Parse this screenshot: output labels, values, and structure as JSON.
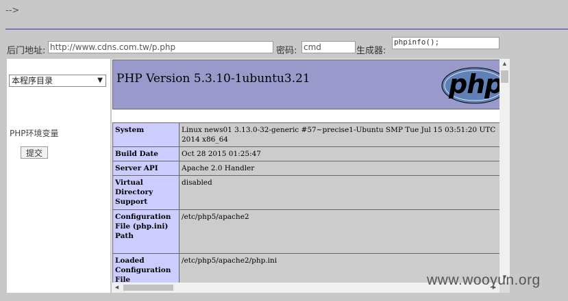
{
  "top": {
    "arrow_text": "-->"
  },
  "form": {
    "backdoor_label": "后门地址:",
    "backdoor_value": "http://www.cdns.com.tw/p.php",
    "password_label": "密码:",
    "password_value": "cmd",
    "generator_label": "生成器:",
    "generator_value": "phpinfo();"
  },
  "sidebar": {
    "dropdown_selected": "本程序目录",
    "env_label": "PHP环境变量",
    "submit_label": "提交"
  },
  "phpinfo": {
    "version_title": "PHP Version 5.3.10-1ubuntu3.21",
    "logo_text": "php",
    "rows": [
      {
        "key": "System",
        "value": "Linux news01 3.13.0-32-generic #57~precise1-Ubuntu SMP Tue Jul 15 03:51:20 UTC 2014 x86_64"
      },
      {
        "key": "Build Date",
        "value": "Oct 28 2015 01:25:47"
      },
      {
        "key": "Server API",
        "value": "Apache 2.0 Handler"
      },
      {
        "key": "Virtual Directory Support",
        "value": "disabled"
      },
      {
        "key": "Configuration File (php.ini) Path",
        "value": "/etc/php5/apache2"
      },
      {
        "key": "Loaded Configuration File",
        "value": "/etc/php5/apache2/php.ini"
      }
    ]
  },
  "watermark": "www.wooyun.org",
  "colors": {
    "page_bg": "#c8c8c8",
    "header_bg": "#9999cc",
    "key_bg": "#ccccff",
    "value_bg": "#cccccc",
    "rule": "#3333aa"
  }
}
